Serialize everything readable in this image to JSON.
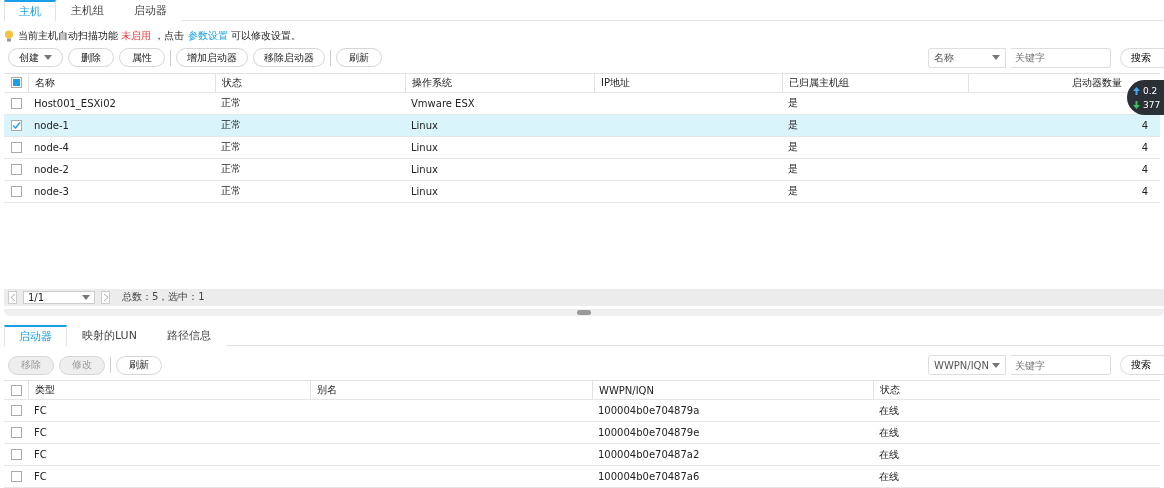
{
  "top_tabs": [
    {
      "label": "主机",
      "selected": true
    },
    {
      "label": "主机组",
      "selected": false
    },
    {
      "label": "启动器",
      "selected": false
    }
  ],
  "notice": {
    "prefix": "当前主机自动扫描功能",
    "status": "未启用",
    "middle": "，点击",
    "link": "参数设置",
    "suffix": "可以修改设置。"
  },
  "toolbar": [
    {
      "label": "创建",
      "kind": "dropdown",
      "disabled": false
    },
    {
      "label": "删除",
      "kind": "button",
      "disabled": false
    },
    {
      "label": "属性",
      "kind": "button",
      "disabled": false
    },
    {
      "kind": "separator"
    },
    {
      "label": "增加启动器",
      "kind": "button",
      "disabled": false
    },
    {
      "label": "移除启动器",
      "kind": "button",
      "disabled": false
    },
    {
      "kind": "separator"
    },
    {
      "label": "刷新",
      "kind": "button",
      "disabled": false
    }
  ],
  "search": {
    "field": "名称",
    "placeholder": "关键字",
    "button": "搜索"
  },
  "hosts_table": {
    "columns": [
      "名称",
      "状态",
      "操作系统",
      "IP地址",
      "已归属主机组",
      "启动器数量"
    ],
    "header_checked": true,
    "rows": [
      {
        "name": "Host001_ESXi02",
        "status": "正常",
        "os": "Vmware ESX",
        "group": "是",
        "selected": false
      },
      {
        "name": "node-1",
        "status": "正常",
        "os": "Linux",
        "group": "是",
        "count": "4",
        "selected": true
      },
      {
        "name": "node-4",
        "status": "正常",
        "os": "Linux",
        "group": "是",
        "count": "4",
        "selected": false
      },
      {
        "name": "node-2",
        "status": "正常",
        "os": "Linux",
        "group": "是",
        "count": "4",
        "selected": false
      },
      {
        "name": "node-3",
        "status": "正常",
        "os": "Linux",
        "group": "是",
        "count": "4",
        "selected": false
      }
    ]
  },
  "pagination": {
    "page": "1/1",
    "summary": "总数：5，选中：1"
  },
  "bottom_tabs": [
    {
      "label": "启动器",
      "selected": true
    },
    {
      "label": "映射的LUN",
      "selected": false
    },
    {
      "label": "路径信息",
      "selected": false
    }
  ],
  "bottom_toolbar": [
    {
      "label": "移除",
      "kind": "button",
      "disabled": true
    },
    {
      "label": "修改",
      "kind": "button",
      "disabled": true
    },
    {
      "kind": "separator"
    },
    {
      "label": "刷新",
      "kind": "button",
      "disabled": false
    }
  ],
  "bottom_search": {
    "field": "WWPN/IQN",
    "placeholder": "关键字",
    "button": "搜索"
  },
  "initiators_table": {
    "columns": [
      "类型",
      "别名",
      "WWPN/IQN",
      "状态"
    ],
    "header_checked": false,
    "rows": [
      {
        "type": "FC",
        "wwpn": "100004b0e704879a",
        "status": "在线",
        "selected": false
      },
      {
        "type": "FC",
        "wwpn": "100004b0e704879e",
        "status": "在线",
        "selected": false
      },
      {
        "type": "FC",
        "wwpn": "100004b0e70487a2",
        "status": "在线",
        "selected": false
      },
      {
        "type": "FC",
        "wwpn": "100004b0e70487a6",
        "status": "在线",
        "selected": false
      }
    ]
  },
  "speed_widget": {
    "upload": "0.2",
    "download": "377"
  }
}
